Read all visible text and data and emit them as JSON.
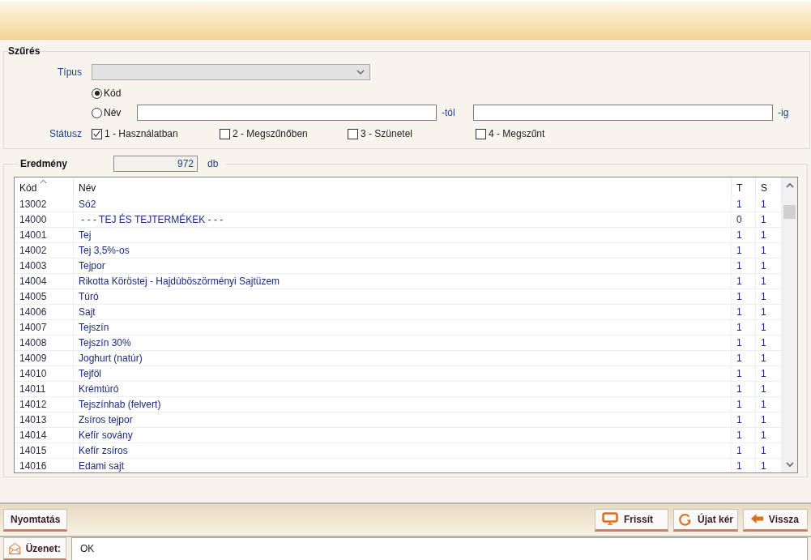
{
  "filter": {
    "title": "Szűrés",
    "type_label": "Típus",
    "search_mode": [
      {
        "label": "Kód",
        "selected": true
      },
      {
        "label": "Név",
        "selected": false
      }
    ],
    "range": {
      "from_suffix": "-tól",
      "to_suffix": "-ig"
    },
    "status": {
      "label": "Státusz",
      "options": [
        {
          "label": "1 - Használatban",
          "checked": true
        },
        {
          "label": "2 - Megszűnőben",
          "checked": false
        },
        {
          "label": "3 - Szünetel",
          "checked": false
        },
        {
          "label": "4 - Megszűnt",
          "checked": false
        }
      ]
    }
  },
  "result": {
    "title": "Eredmény",
    "count": "972",
    "unit": "db"
  },
  "table": {
    "columns": [
      {
        "label": "Kód",
        "sorted": true
      },
      {
        "label": "Név",
        "sorted": false
      },
      {
        "label": "T",
        "sorted": false
      },
      {
        "label": "S",
        "sorted": false
      }
    ],
    "rows": [
      [
        "13002",
        "Só2",
        "1",
        "1"
      ],
      [
        "14000",
        " - - - TEJ ÉS TEJTERMÉKEK - - -",
        "0",
        "1"
      ],
      [
        "14001",
        "Tej",
        "1",
        "1"
      ],
      [
        "14002",
        "Tej 3,5%-os",
        "1",
        "1"
      ],
      [
        "14003",
        "Tejpor",
        "1",
        "1"
      ],
      [
        "14004",
        "Rikotta Köröstej - Hajdúböszörményi Sajtüzem",
        "1",
        "1"
      ],
      [
        "14005",
        "Túró",
        "1",
        "1"
      ],
      [
        "14006",
        "Sajt",
        "1",
        "1"
      ],
      [
        "14007",
        "Tejszín",
        "1",
        "1"
      ],
      [
        "14008",
        "Tejszín 30%",
        "1",
        "1"
      ],
      [
        "14009",
        "Joghurt (natúr)",
        "1",
        "1"
      ],
      [
        "14010",
        "Tejföl",
        "1",
        "1"
      ],
      [
        "14011",
        "Krémtúró",
        "1",
        "1"
      ],
      [
        "14012",
        "Tejszínhab (felvert)",
        "1",
        "1"
      ],
      [
        "14013",
        "Zsíros tejpor",
        "1",
        "1"
      ],
      [
        "14014",
        "Kefír sovány",
        "1",
        "1"
      ],
      [
        "14015",
        "Kefír zsíros",
        "1",
        "1"
      ],
      [
        "14016",
        "Edami sajt",
        "1",
        "1"
      ]
    ]
  },
  "toolbar": {
    "left_buttons": [
      {
        "label": "Nyomtatás"
      }
    ],
    "right_buttons": [
      {
        "label": "Frissít",
        "kind": "monitor"
      },
      {
        "label": "Újat kér",
        "kind": "refresh"
      },
      {
        "label": "Vissza",
        "kind": "back"
      }
    ]
  },
  "message": {
    "label": "Üzenet:",
    "text": "OK"
  }
}
